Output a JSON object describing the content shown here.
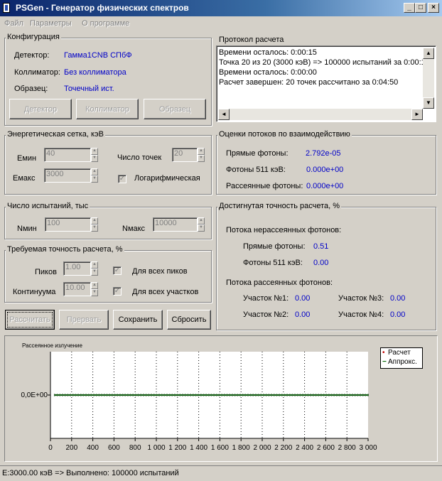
{
  "window": {
    "title": "PSGen - Генератор физических спектров"
  },
  "menu": [
    "Файл",
    "Параметры",
    "О программе"
  ],
  "config": {
    "title": "Конфигурация",
    "detector_label": "Детектор:",
    "detector_value": "Гамма1CNB СПбФ",
    "collimator_label": "Коллиматор:",
    "collimator_value": "Без коллиматора",
    "sample_label": "Образец:",
    "sample_value": "Точечный ист.",
    "btn_detector": "Детектор",
    "btn_collimator": "Коллиматор",
    "btn_sample": "Образец"
  },
  "log": {
    "title": "Протокол расчета",
    "lines": [
      "Времени осталось: 0:00:15",
      "Точка 20 из 20 (3000 кэВ) => 100000 испытаний за 0:00:14",
      "Времени осталось: 0:00:00",
      "Расчет завершен: 20 точек рассчитано за 0:04:50"
    ]
  },
  "energy": {
    "title": "Энергетическая сетка, кэВ",
    "emin_label": "Емин",
    "emin_value": "40",
    "emax_label": "Емакс",
    "emax_value": "3000",
    "points_label": "Число точек",
    "points_value": "20",
    "log_label": "Логарифмическая",
    "log_checked": "✓"
  },
  "trials": {
    "title": "Число испытаний, тыс",
    "nmin_label": "Nмин",
    "nmin_value": "100",
    "nmax_label": "Nмакс",
    "nmax_value": "10000"
  },
  "accuracy": {
    "title": "Требуемая точность расчета, %",
    "peaks_label": "Пиков",
    "peaks_value": "1.00",
    "cont_label": "Континуума",
    "cont_value": "10.00",
    "all_peaks_label": "Для всех пиков",
    "all_peaks_checked": "✓",
    "all_parts_label": "Для всех участков",
    "all_parts_checked": "✓"
  },
  "buttons": {
    "calc": "Рассчитать",
    "stop": "Прервать",
    "save": "Сохранить",
    "reset": "Сбросить"
  },
  "flux": {
    "title": "Оценки потоков по взаимодействию",
    "direct_label": "Прямые фотоны:",
    "direct_value": "2.792e-05",
    "f511_label": "Фотоны 511 кэВ:",
    "f511_value": "0.000e+00",
    "scatter_label": "Рассеянные фотоны:",
    "scatter_value": "0.000e+00"
  },
  "precision": {
    "title": "Достигнутая точность расчета, %",
    "unscattered_label": "Потока нерассеянных фотонов:",
    "direct_label": "Прямые фотоны:",
    "direct_value": "0.51",
    "f511_label": "Фотоны 511 кэВ:",
    "f511_value": "0.00",
    "scattered_label": "Потока рассеянных фотонов:",
    "sec1_label": "Участок №1:",
    "sec1_value": "0.00",
    "sec2_label": "Участок №2:",
    "sec2_value": "0.00",
    "sec3_label": "Участок №3:",
    "sec3_value": "0.00",
    "sec4_label": "Участок №4:",
    "sec4_value": "0.00"
  },
  "chart_data": {
    "type": "line",
    "title": "Рассеянное излучение",
    "xlim": [
      0,
      3000
    ],
    "x_ticks": [
      "0",
      "200",
      "400",
      "600",
      "800",
      "1 000",
      "1 200",
      "1 400",
      "1 600",
      "1 800",
      "2 000",
      "2 200",
      "2 400",
      "2 600",
      "2 800",
      "3 000"
    ],
    "y_ticks": [
      "0,0E+00"
    ],
    "grid": true,
    "legend_position": "top-right",
    "series": [
      {
        "name": "Расчет",
        "color": "#c00000",
        "x": [
          40,
          3000
        ],
        "y": [
          0,
          0
        ]
      },
      {
        "name": "Аппрокс.",
        "color": "#006400",
        "x": [
          40,
          3000
        ],
        "y": [
          0,
          0
        ]
      }
    ]
  },
  "status": {
    "text": "E:3000.00 кэВ => Выполнено: 100000 испытаний"
  }
}
